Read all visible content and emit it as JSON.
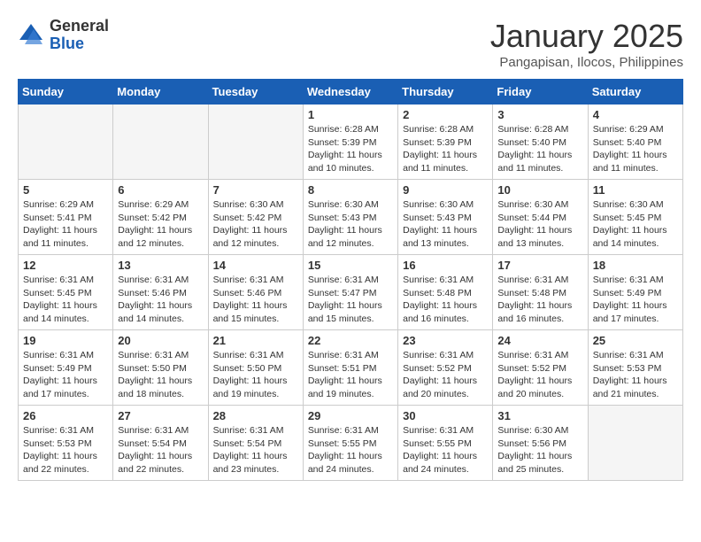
{
  "logo": {
    "general": "General",
    "blue": "Blue"
  },
  "header": {
    "title": "January 2025",
    "subtitle": "Pangapisan, Ilocos, Philippines"
  },
  "weekdays": [
    "Sunday",
    "Monday",
    "Tuesday",
    "Wednesday",
    "Thursday",
    "Friday",
    "Saturday"
  ],
  "weeks": [
    [
      {
        "day": "",
        "info": ""
      },
      {
        "day": "",
        "info": ""
      },
      {
        "day": "",
        "info": ""
      },
      {
        "day": "1",
        "sunrise": "6:28 AM",
        "sunset": "5:39 PM",
        "daylight": "11 hours and 10 minutes."
      },
      {
        "day": "2",
        "sunrise": "6:28 AM",
        "sunset": "5:39 PM",
        "daylight": "11 hours and 11 minutes."
      },
      {
        "day": "3",
        "sunrise": "6:28 AM",
        "sunset": "5:40 PM",
        "daylight": "11 hours and 11 minutes."
      },
      {
        "day": "4",
        "sunrise": "6:29 AM",
        "sunset": "5:40 PM",
        "daylight": "11 hours and 11 minutes."
      }
    ],
    [
      {
        "day": "5",
        "sunrise": "6:29 AM",
        "sunset": "5:41 PM",
        "daylight": "11 hours and 11 minutes."
      },
      {
        "day": "6",
        "sunrise": "6:29 AM",
        "sunset": "5:42 PM",
        "daylight": "11 hours and 12 minutes."
      },
      {
        "day": "7",
        "sunrise": "6:30 AM",
        "sunset": "5:42 PM",
        "daylight": "11 hours and 12 minutes."
      },
      {
        "day": "8",
        "sunrise": "6:30 AM",
        "sunset": "5:43 PM",
        "daylight": "11 hours and 12 minutes."
      },
      {
        "day": "9",
        "sunrise": "6:30 AM",
        "sunset": "5:43 PM",
        "daylight": "11 hours and 13 minutes."
      },
      {
        "day": "10",
        "sunrise": "6:30 AM",
        "sunset": "5:44 PM",
        "daylight": "11 hours and 13 minutes."
      },
      {
        "day": "11",
        "sunrise": "6:30 AM",
        "sunset": "5:45 PM",
        "daylight": "11 hours and 14 minutes."
      }
    ],
    [
      {
        "day": "12",
        "sunrise": "6:31 AM",
        "sunset": "5:45 PM",
        "daylight": "11 hours and 14 minutes."
      },
      {
        "day": "13",
        "sunrise": "6:31 AM",
        "sunset": "5:46 PM",
        "daylight": "11 hours and 14 minutes."
      },
      {
        "day": "14",
        "sunrise": "6:31 AM",
        "sunset": "5:46 PM",
        "daylight": "11 hours and 15 minutes."
      },
      {
        "day": "15",
        "sunrise": "6:31 AM",
        "sunset": "5:47 PM",
        "daylight": "11 hours and 15 minutes."
      },
      {
        "day": "16",
        "sunrise": "6:31 AM",
        "sunset": "5:48 PM",
        "daylight": "11 hours and 16 minutes."
      },
      {
        "day": "17",
        "sunrise": "6:31 AM",
        "sunset": "5:48 PM",
        "daylight": "11 hours and 16 minutes."
      },
      {
        "day": "18",
        "sunrise": "6:31 AM",
        "sunset": "5:49 PM",
        "daylight": "11 hours and 17 minutes."
      }
    ],
    [
      {
        "day": "19",
        "sunrise": "6:31 AM",
        "sunset": "5:49 PM",
        "daylight": "11 hours and 17 minutes."
      },
      {
        "day": "20",
        "sunrise": "6:31 AM",
        "sunset": "5:50 PM",
        "daylight": "11 hours and 18 minutes."
      },
      {
        "day": "21",
        "sunrise": "6:31 AM",
        "sunset": "5:50 PM",
        "daylight": "11 hours and 19 minutes."
      },
      {
        "day": "22",
        "sunrise": "6:31 AM",
        "sunset": "5:51 PM",
        "daylight": "11 hours and 19 minutes."
      },
      {
        "day": "23",
        "sunrise": "6:31 AM",
        "sunset": "5:52 PM",
        "daylight": "11 hours and 20 minutes."
      },
      {
        "day": "24",
        "sunrise": "6:31 AM",
        "sunset": "5:52 PM",
        "daylight": "11 hours and 20 minutes."
      },
      {
        "day": "25",
        "sunrise": "6:31 AM",
        "sunset": "5:53 PM",
        "daylight": "11 hours and 21 minutes."
      }
    ],
    [
      {
        "day": "26",
        "sunrise": "6:31 AM",
        "sunset": "5:53 PM",
        "daylight": "11 hours and 22 minutes."
      },
      {
        "day": "27",
        "sunrise": "6:31 AM",
        "sunset": "5:54 PM",
        "daylight": "11 hours and 22 minutes."
      },
      {
        "day": "28",
        "sunrise": "6:31 AM",
        "sunset": "5:54 PM",
        "daylight": "11 hours and 23 minutes."
      },
      {
        "day": "29",
        "sunrise": "6:31 AM",
        "sunset": "5:55 PM",
        "daylight": "11 hours and 24 minutes."
      },
      {
        "day": "30",
        "sunrise": "6:31 AM",
        "sunset": "5:55 PM",
        "daylight": "11 hours and 24 minutes."
      },
      {
        "day": "31",
        "sunrise": "6:30 AM",
        "sunset": "5:56 PM",
        "daylight": "11 hours and 25 minutes."
      },
      {
        "day": "",
        "info": ""
      }
    ]
  ],
  "labels": {
    "sunrise": "Sunrise:",
    "sunset": "Sunset:",
    "daylight": "Daylight:"
  }
}
